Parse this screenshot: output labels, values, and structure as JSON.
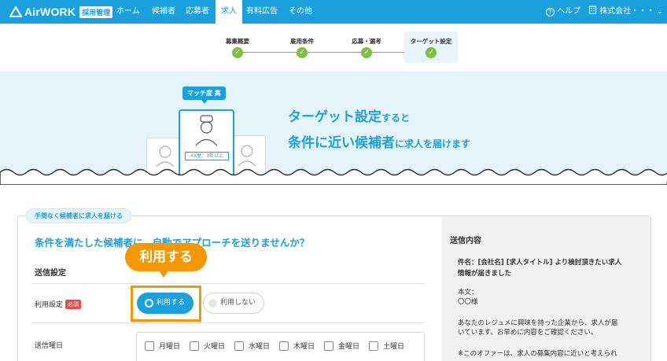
{
  "nav": {
    "logo_text": "AirWORK",
    "logo_badge": "採用管理",
    "items": [
      {
        "label": "ホーム"
      },
      {
        "label": "候補者"
      },
      {
        "label": "応募者"
      },
      {
        "label": "求人"
      },
      {
        "label": "有料広告"
      },
      {
        "label": "その他"
      }
    ],
    "active_index": 3,
    "help_label": "ヘルプ",
    "company_label": "株式会社・・・",
    "accent_color": "#1aa0dc"
  },
  "steps": [
    {
      "label": "募集概要",
      "done": true
    },
    {
      "label": "雇用条件",
      "done": true
    },
    {
      "label": "応募・選考",
      "done": true
    },
    {
      "label": "ターゲット設定",
      "done": true,
      "current": true
    }
  ],
  "hero": {
    "match_badge": "マッチ度 高",
    "experience_tag": "XX歴：3年以上",
    "title1_main": "ターゲット設定",
    "title1_tail": "すると",
    "title2_main": "条件に近い候補者",
    "title2_tail": "に求人を届けます"
  },
  "settings": {
    "tag": "手間なく候補者に求人を届ける",
    "headline": "条件を満たした候補者に、自動でアプローチを送りませんか？",
    "section_title": "送信設定",
    "usage_label": "利用設定",
    "required_badge": "必須",
    "callout": "利用する",
    "option_on": "利用する",
    "option_off": "利用しない",
    "days_label": "送信曜日",
    "days": [
      "月曜日",
      "火曜日",
      "水曜日",
      "木曜日",
      "金曜日",
      "土曜日"
    ]
  },
  "preview": {
    "title": "送信内容",
    "subject_line1": "件名：[会社名] [求人タイトル] より検討頂きたい求人",
    "subject_line2": "情報が届きました",
    "body_label": "本文：",
    "recipient": "〇〇様",
    "para1_line1": "あなたのレジュメに興味を持った企業から、求人が届",
    "para1_line2": "いています。お早めに内容をご確認ください。",
    "para2_line1": "※このオファーは、求人の募集内容に近いと考えられ"
  }
}
